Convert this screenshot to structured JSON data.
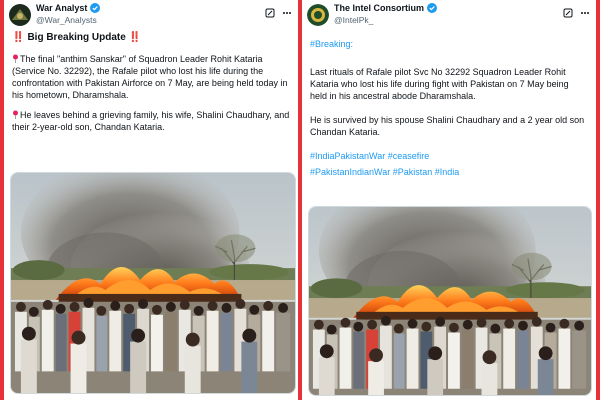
{
  "left_post": {
    "author_name": "War Analyst",
    "author_handle": "@War_Analysts",
    "headline_marks_left": "‼️",
    "headline": "Big Breaking Update",
    "headline_marks_right": "‼️",
    "paragraph_1": "The final \"anthim Sanskar\" of Squadron Leader Rohit Kataria (Service No. 32292), the Rafale pilot who lost his life during the confrontation with Pakistan Airforce on 7 May, are being held today in his hometown, Dharamshala.",
    "paragraph_2": "He leaves behind a grieving family, his wife, Shalini Chaudhary, and their 2-year-old son, Chandan Kataria.",
    "icons": [
      "verified-badge-icon",
      "grok-icon",
      "more-icon",
      "pin-icon",
      "funeral-pyre-photo"
    ]
  },
  "right_post": {
    "author_name": "The Intel Consortium",
    "author_handle": "@IntelPk_",
    "hashtag_breaking": "#Breaking:",
    "paragraph_1": "Last rituals of Rafale pilot Svc No 32292 Squadron Leader Rohit Kataria who lost his life during fight with Pakistan on 7 May being held in his ancestral abode Dharamshala.",
    "paragraph_2": "He is survived by his spouse Shalini Chaudhary and a 2 year old son Chandan Kataria.",
    "hashtags_line_1": "#IndiaPakistanWar #ceasefire",
    "hashtags_line_2": "#PakistanIndianWar #Pakistan #India",
    "icons": [
      "verified-badge-icon",
      "grok-icon",
      "more-icon",
      "funeral-pyre-photo"
    ]
  },
  "colors": {
    "frame_red": "#e8323a",
    "link_blue": "#1d9bf0",
    "text": "#0f1419",
    "muted": "#536471"
  }
}
